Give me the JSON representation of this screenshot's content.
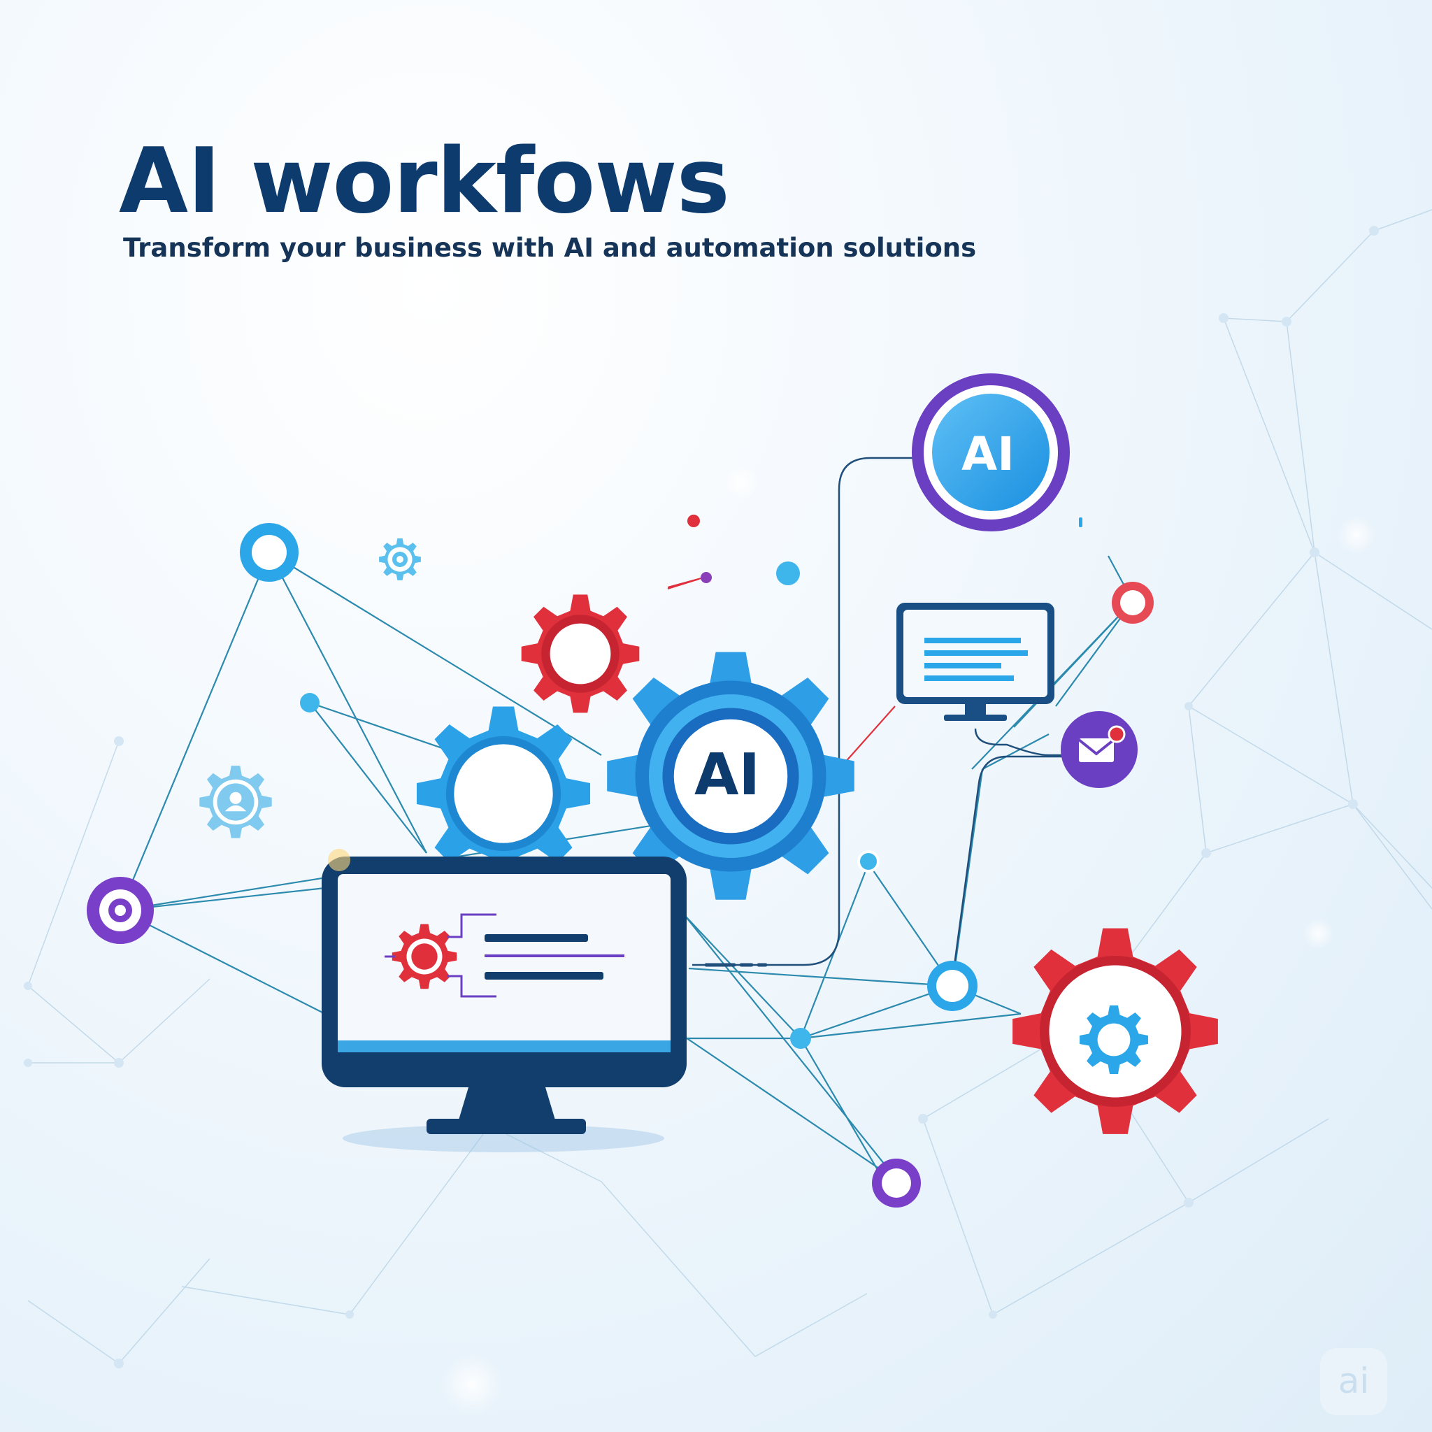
{
  "headline": "AI workfows",
  "subheadline": "Transform your business with AI and automation solutions",
  "badges": {
    "top_node_label": "AI",
    "central_gear_label": "AI",
    "watermark_label": "ai"
  },
  "colors": {
    "navy": "#0e3b6e",
    "blue": "#1e9be8",
    "red": "#e0303c",
    "purple": "#6b3fc2",
    "line": "#2d86a8"
  },
  "icons": [
    "gear-icon",
    "ai-node-icon",
    "desktop-monitor-icon",
    "small-monitor-icon",
    "mail-icon",
    "user-gear-icon",
    "network-node-icon",
    "ai-watermark-icon"
  ]
}
